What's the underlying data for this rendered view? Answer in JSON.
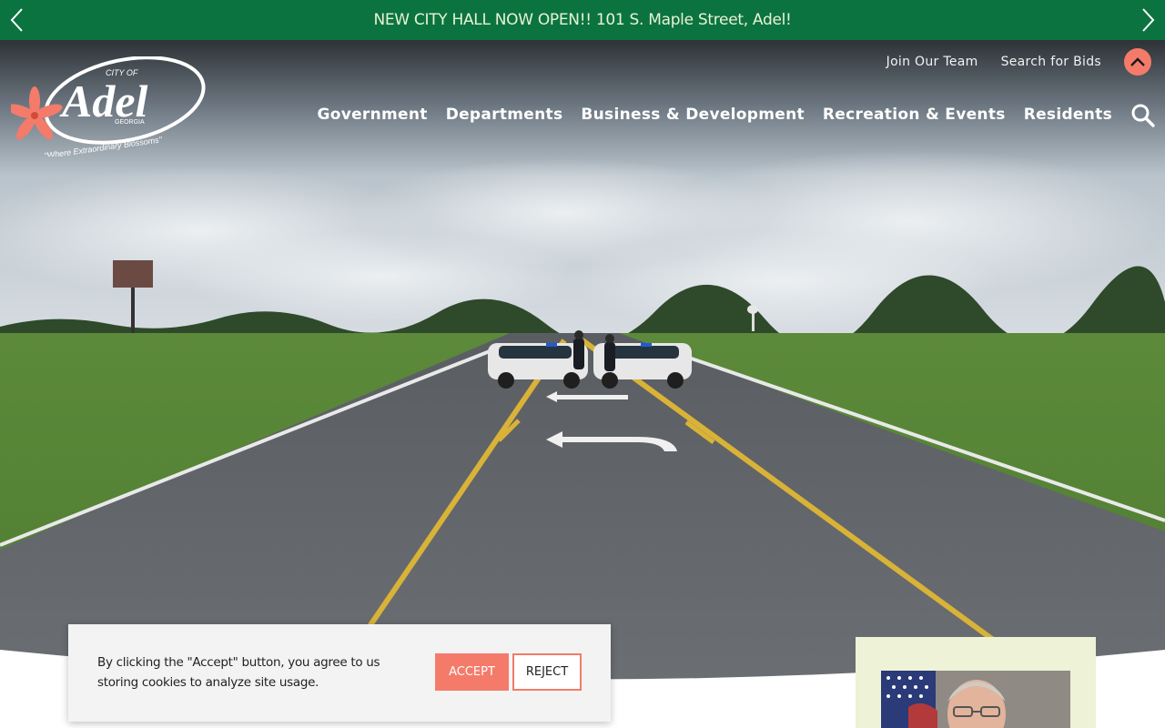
{
  "announcement": {
    "text": "NEW CITY HALL NOW OPEN!! 101 S. Maple Street, Adel!",
    "prev_icon": "chevron-left-icon",
    "next_icon": "chevron-right-icon"
  },
  "logo": {
    "top_text": "CITY OF",
    "name": "Adel",
    "state": "GEORGIA",
    "tagline": "\"Where Extraordinary Blossoms\""
  },
  "utility_nav": {
    "join": "Join Our Team",
    "bids": "Search for Bids",
    "scroll_icon": "chevron-up-icon"
  },
  "main_nav": {
    "items": [
      {
        "label": "Government"
      },
      {
        "label": "Departments"
      },
      {
        "label": "Business & Development"
      },
      {
        "label": "Recreation & Events"
      },
      {
        "label": "Residents"
      }
    ],
    "search_icon": "search-icon"
  },
  "cookie": {
    "text": "By clicking the \"Accept\" button, you agree to us storing cookies to analyze site usage.",
    "accept": "ACCEPT",
    "reject": "REJECT"
  },
  "colors": {
    "announce_bg": "#0b7340",
    "accent": "#f47b6a",
    "card_bg": "#eef2d6"
  }
}
